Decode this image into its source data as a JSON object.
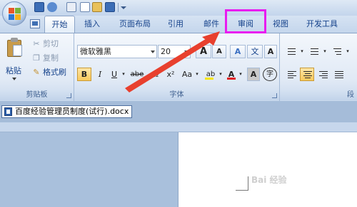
{
  "tabs": [
    {
      "label": "开始",
      "active": true
    },
    {
      "label": "插入"
    },
    {
      "label": "页面布局"
    },
    {
      "label": "引用"
    },
    {
      "label": "邮件"
    },
    {
      "label": "审阅"
    },
    {
      "label": "视图"
    },
    {
      "label": "开发工具"
    }
  ],
  "clipboard": {
    "paste_label": "粘贴",
    "cut_label": "剪切",
    "copy_label": "复制",
    "format_painter_label": "格式刷",
    "group_label": "剪贴板"
  },
  "font": {
    "font_name": "微软雅黑",
    "font_size": "20",
    "grow_label": "A",
    "shrink_label": "A",
    "clear_label": "A",
    "phonetic_label": "文",
    "border_char_label": "A",
    "bold": "B",
    "italic": "I",
    "underline": "U",
    "strikethrough": "abe",
    "subscript": "x₂",
    "superscript": "x²",
    "change_case": "Aa",
    "highlight": "ab",
    "font_color": "A",
    "char_shading": "A",
    "enclose_char": "字",
    "group_label": "字体"
  },
  "paragraph": {
    "group_label": "段"
  },
  "document": {
    "tab_title": "百度经验管理员制度(试行).docx"
  },
  "watermark_text": "Bai 经验",
  "colors": {
    "highlight_box": "#e81bf0",
    "arrow": "#e8402e",
    "font_color_bar": "#e02020",
    "highlight_bar": "#f5e500"
  }
}
